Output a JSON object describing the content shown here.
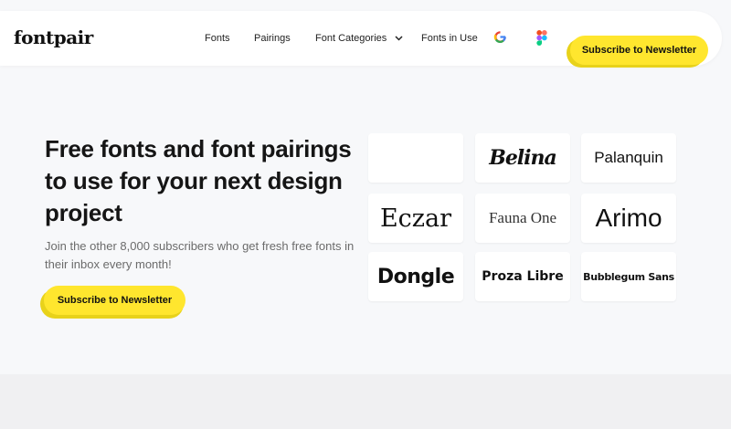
{
  "header": {
    "logo": "fontpair",
    "nav": [
      "Fonts",
      "Pairings",
      "Font Categories",
      "Fonts in Use"
    ],
    "icons": [
      "google-icon",
      "figma-icon",
      "chevron-down-icon"
    ],
    "cta": "Subscribe to Newsletter"
  },
  "hero": {
    "title": "Free fonts and font pairings to use for your next design project",
    "subtitle": "Join the other 8,000 subscribers who get fresh free fonts in their inbox every month!",
    "cta": "Subscribe to Newsletter"
  },
  "font_cards": [
    "",
    "Belina",
    "Palanquin",
    "Eczar",
    "Fauna One",
    "Arimo",
    "Dongle",
    "Proza Libre",
    "Bubblegum Sans"
  ],
  "colors": {
    "accent": "#ffe62e",
    "accent_shadow": "#e8d21a",
    "page_bg": "#f7f8fa",
    "card_bg": "#ffffff",
    "text": "#151515",
    "muted_text": "#6b6b6b"
  }
}
